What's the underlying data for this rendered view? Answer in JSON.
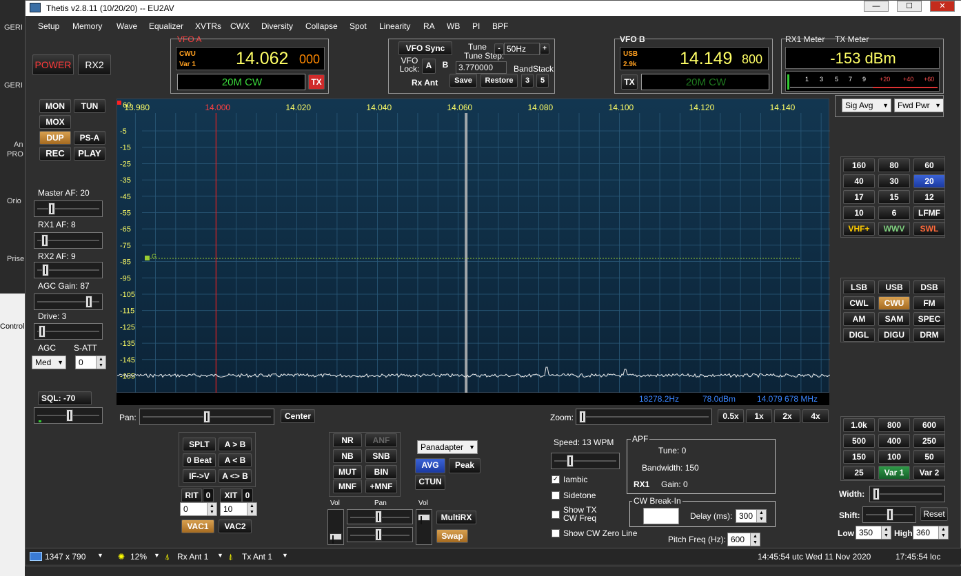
{
  "desktop": {
    "labels": [
      "GERI",
      "GERI",
      "An",
      "PRO",
      "Orio",
      "Prise"
    ],
    "control_label": "Control"
  },
  "window": {
    "title": "Thetis v2.8.11 (10/20/20)  --  EU2AV",
    "minimize": "—",
    "maximize": "☐",
    "close": "✕"
  },
  "menu": [
    "Setup",
    "Memory",
    "Wave",
    "Equalizer",
    "XVTRs",
    "CWX",
    "Diversity",
    "Collapse",
    "Spot",
    "Linearity",
    "RA",
    "WB",
    "PI",
    "BPF"
  ],
  "left": {
    "power": "POWER",
    "rx2": "RX2",
    "mon": "MON",
    "tun": "TUN",
    "mox": "MOX",
    "dup": "DUP",
    "psa": "PS-A",
    "rec": "REC",
    "play": "PLAY",
    "master_af": "Master AF:  20",
    "rx1_af": "RX1 AF:  8",
    "rx2_af": "RX2 AF:  9",
    "agc_gain": "AGC Gain:  87",
    "drive": "Drive:  3",
    "agc_label": "AGC",
    "satt_label": "S-ATT",
    "agc_value": "Med",
    "satt_value": "0",
    "sql": "SQL: -70",
    "master_af_level": 20,
    "rx1_af_level": 8,
    "rx2_af_level": 9,
    "agc_gain_level": 87,
    "drive_level": 3
  },
  "vfoa": {
    "label": "VFO A",
    "mode": "CWU",
    "filter": "Var 1",
    "freq_main": "14.062",
    "freq_sub": "000",
    "band": "20M CW",
    "tx": "TX"
  },
  "vfo_center": {
    "sync": "VFO Sync",
    "tune_step_label": "Tune Step:",
    "tune_step": "50Hz",
    "minus": "-",
    "plus": "+",
    "lock_label": "VFO Lock:",
    "a": "A",
    "b": "B",
    "freq": "3.770000",
    "bandstack": "BandStack",
    "rx_ant": "Rx Ant",
    "save": "Save",
    "restore": "Restore",
    "n3": "3",
    "n5": "5"
  },
  "vfob": {
    "label": "VFO B",
    "mode": "USB",
    "filter": "2.9k",
    "freq_main": "14.149",
    "freq_sub": "800",
    "band": "20M CW",
    "tx": "TX"
  },
  "meter": {
    "rx1_label": "RX1 Meter",
    "tx_label": "TX Meter",
    "value": "-153 dBm",
    "scale": [
      "1",
      "3",
      "5",
      "7",
      "9",
      "+20",
      "+40",
      "+60"
    ],
    "rx_mode": "Sig Avg",
    "tx_mode": "Fwd Pwr"
  },
  "panadapter": {
    "freq_labels": [
      "13.980",
      "14.000",
      "14.020",
      "14.040",
      "14.060",
      "14.080",
      "14.100",
      "14.120",
      "14.140"
    ],
    "db_labels": [
      "60",
      "-5",
      "-15",
      "-25",
      "-35",
      "-45",
      "-55",
      "-65",
      "-75",
      "-85",
      "-95",
      "-105",
      "-115",
      "-125",
      "-135",
      "-145",
      "-155"
    ],
    "marker": "G",
    "readout_hz": "18278.2Hz",
    "readout_dbm": "78.0dBm",
    "readout_mhz": "14.079 678 MHz"
  },
  "pan_controls": {
    "pan_label": "Pan:",
    "center": "Center",
    "zoom_label": "Zoom:",
    "z05": "0.5x",
    "z1": "1x",
    "z2": "2x",
    "z4": "4x"
  },
  "bands": [
    "160",
    "80",
    "60",
    "40",
    "30",
    "20",
    "17",
    "15",
    "12",
    "10",
    "6",
    "LFMF",
    "VHF+",
    "WWV",
    "SWL"
  ],
  "modes": [
    "LSB",
    "USB",
    "DSB",
    "CWL",
    "CWU",
    "FM",
    "AM",
    "SAM",
    "SPEC",
    "DIGL",
    "DIGU",
    "DRM"
  ],
  "filters": [
    "1.0k",
    "800",
    "600",
    "500",
    "400",
    "250",
    "150",
    "100",
    "50",
    "25",
    "Var 1",
    "Var 2"
  ],
  "filter_controls": {
    "width": "Width:",
    "shift": "Shift:",
    "reset": "Reset",
    "low_label": "Low",
    "low": "350",
    "high_label": "High",
    "high": "360"
  },
  "split": {
    "splt": "SPLT",
    "atob": "A > B",
    "zerobeat": "0 Beat",
    "btoa": "A < B",
    "ifv": "IF->V",
    "swapab": "A <> B",
    "rit": "RIT",
    "rit_v": "0",
    "xit": "XIT",
    "xit_v": "0",
    "rit_val": "0",
    "xit_val": "10",
    "vac1": "VAC1",
    "vac2": "VAC2"
  },
  "dsp": {
    "nr": "NR",
    "anf": "ANF",
    "nb": "NB",
    "snb": "SNB",
    "mut": "MUT",
    "bin": "BIN",
    "mnf": "MNF",
    "pmnf": "+MNF",
    "display_mode": "Panadapter",
    "avg": "AVG",
    "peak": "Peak",
    "ctun": "CTUN",
    "vol": "Vol",
    "pan": "Pan",
    "vol2": "Vol",
    "multirx": "MultiRX",
    "swap": "Swap"
  },
  "cw": {
    "speed": "Speed:  13 WPM",
    "iambic": "Iambic",
    "sidetone": "Sidetone",
    "show_tx": "Show TX",
    "cw_freq": "CW Freq",
    "zero_line": "Show CW Zero Line",
    "apf": "APF",
    "tune": "Tune:  0",
    "bandwidth": "Bandwidth:  150",
    "rx1": "RX1",
    "gain": "Gain:  0",
    "breakin": "CW Break-In",
    "delay_label": "Delay (ms):",
    "delay": "300",
    "pitch_label": "Pitch Freq (Hz):",
    "pitch": "600"
  },
  "status": {
    "res": "1347 x 790",
    "cpu": "12%",
    "rxant": "Rx Ant  1",
    "txant": "Tx Ant  1",
    "utc": "14:45:54 utc  Wed 11 Nov 2020",
    "loc": "17:45:54 loc"
  },
  "colors": {
    "accent_blue": "#2b4fd0",
    "vfo_yellow": "#ffff66",
    "band_green": "#3ad93a",
    "tx_red": "#e23030",
    "pan_bg": "#0f2d44"
  }
}
